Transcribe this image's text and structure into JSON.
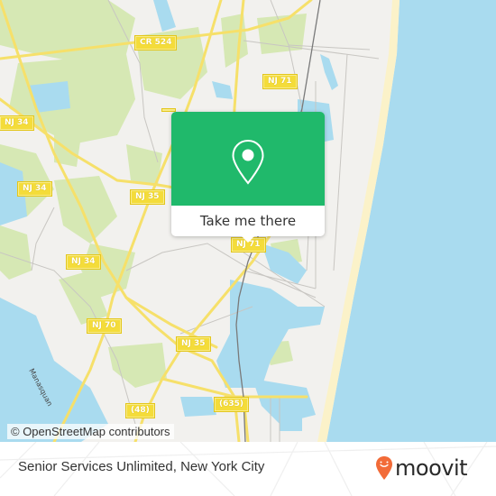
{
  "map": {
    "attribution": "© OpenStreetMap contributors",
    "colors": {
      "land": "#f2f1ee",
      "green": "#d6e8b4",
      "water": "#a9dbef",
      "beach": "#fbf2c9",
      "road": "#f6e06a",
      "minor_road": "#c8c6c2",
      "rail": "#7a7a7a"
    },
    "shields": [
      {
        "label": "CR 524"
      },
      {
        "label": "NJ 71"
      },
      {
        "label": "NJ 34"
      },
      {
        "label": "NJ 34"
      },
      {
        "label": "NJ 35"
      },
      {
        "label": "NJ 34"
      },
      {
        "label": "NJ 70"
      },
      {
        "label": "NJ 35"
      },
      {
        "label": "(48)"
      },
      {
        "label": "(635)"
      },
      {
        "label": "NJ 71"
      }
    ],
    "water_label": "Manasquan"
  },
  "popup": {
    "icon": "map-pin-icon",
    "action_label": "Take me there",
    "color": "#20b96b"
  },
  "footer": {
    "title": "Senior Services Unlimited, New York City",
    "brand": "moovit",
    "brand_color": "#f26b38"
  }
}
